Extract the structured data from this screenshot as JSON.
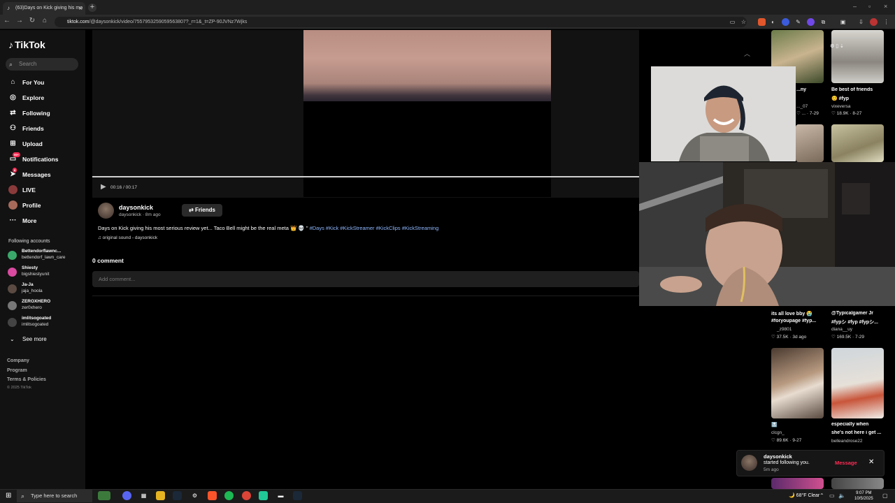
{
  "browser": {
    "tab_title": "(63)Days on Kick giving his mo",
    "url_host": "tiktok.com",
    "url_path": "/@daysonkick/video/7557953259059563807?_r=1&_t=ZP-90JVNz7Wjks"
  },
  "sidebar": {
    "logo": "TikTok",
    "search_placeholder": "Search",
    "nav": [
      {
        "label": "For You",
        "icon": "home-icon"
      },
      {
        "label": "Explore",
        "icon": "compass-icon"
      },
      {
        "label": "Following",
        "icon": "following-icon"
      },
      {
        "label": "Friends",
        "icon": "friends-icon"
      },
      {
        "label": "Upload",
        "icon": "upload-icon"
      },
      {
        "label": "Notifications",
        "icon": "inbox-icon",
        "badge": "99+"
      },
      {
        "label": "Messages",
        "icon": "messages-icon",
        "badge": "8"
      },
      {
        "label": "LIVE",
        "icon": "live-icon"
      },
      {
        "label": "Profile",
        "icon": "profile-icon"
      },
      {
        "label": "More",
        "icon": "more-icon"
      }
    ],
    "following_title": "Following accounts",
    "following": [
      {
        "name": "Bettendorflawnc...",
        "handle": "bettendorf_lawn_care"
      },
      {
        "name": "Shiesty",
        "handle": "bigshiestyunit"
      },
      {
        "name": "Ja-Ja",
        "handle": "jaja_hoola"
      },
      {
        "name": "ZEROXHERO",
        "handle": "zer0xhero"
      },
      {
        "name": "imlitsogoated",
        "handle": "imlitsogoated"
      }
    ],
    "see_more": "See more",
    "footer": [
      "Company",
      "Program",
      "Terms & Policies"
    ],
    "copyright": "© 2025 TikTok"
  },
  "video": {
    "time": "00:16 / 00:17",
    "progress": 1.0
  },
  "post": {
    "author": "daysonkick",
    "meta": "daysonkick · 8m ago",
    "friends_button": "Friends",
    "caption_text": "Days on Kick giving his most serious review yet... Taco Bell might be the real meta 👑 💀 \"",
    "caption_tags": "#Days #Kick #KickStreamer #KickClips #KickStreaming",
    "sound": "♫ original sound - daysonkick",
    "comment_count": "0 comment",
    "comment_placeholder": "Add comment..."
  },
  "grid": [
    {
      "caption": "...ny",
      "user": "..._07",
      "stats": "♡ ... · 7-29"
    },
    {
      "caption": "Be best of friends",
      "caption2": "😊 #fyp",
      "user": "vixeversa",
      "stats": "♡ 18.9K · 8-27"
    },
    {
      "caption": "its all love bby 😭",
      "caption2": "#foryoupage #fyp...",
      "user": "_z9801",
      "stats": "♡ 37.5K · 3d ago"
    },
    {
      "caption": "@Typicalgamer Jr",
      "caption2": "#fypシ #fyp #fypシ...",
      "user": "diana__uy",
      "stats": "♡ 169.5K · 7-29"
    },
    {
      "caption": "🔝",
      "user": "clcgn_",
      "stats": "♡ 89.6K · 9-27"
    },
    {
      "caption": "especially when",
      "caption2": "she's not here i get ...",
      "user": "belleandrose22",
      "stats": "♡ 65.4K · ..."
    }
  ],
  "toast": {
    "name": "daysonkick",
    "text": "started following you.",
    "time": "5m ago",
    "action": "Message"
  },
  "taskbar": {
    "search_placeholder": "Type here to search",
    "weather": "68°F  Clear",
    "time": "9:07 PM",
    "date": "10/5/2025"
  },
  "colors": {
    "accent": "#fe2c55",
    "link": "#8fb8ff",
    "background": "#121212"
  }
}
